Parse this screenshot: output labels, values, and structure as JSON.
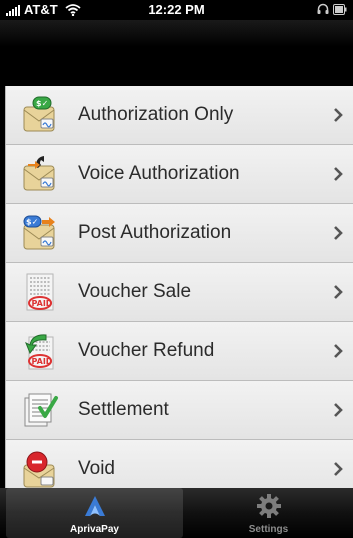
{
  "status_bar": {
    "carrier": "AT&T",
    "time": "12:22 PM"
  },
  "menu": {
    "items": [
      {
        "label": "Authorization Only",
        "icon": "authorization-icon"
      },
      {
        "label": "Voice Authorization",
        "icon": "voice-authorization-icon"
      },
      {
        "label": "Post Authorization",
        "icon": "post-authorization-icon"
      },
      {
        "label": "Voucher Sale",
        "icon": "voucher-sale-icon"
      },
      {
        "label": "Voucher Refund",
        "icon": "voucher-refund-icon"
      },
      {
        "label": "Settlement",
        "icon": "settlement-icon"
      },
      {
        "label": "Void",
        "icon": "void-icon"
      }
    ]
  },
  "tab_bar": {
    "tabs": [
      {
        "label": "AprivaPay",
        "icon": "apriva-logo-icon",
        "active": true
      },
      {
        "label": "Settings",
        "icon": "gear-icon",
        "active": false
      }
    ]
  },
  "colors": {
    "nav_background": "#000000",
    "list_background": "#e9e9e9",
    "row_separator": "#bcbcbc",
    "label_text": "#2b2b2b",
    "tab_active_label": "#ffffff",
    "tab_inactive_label": "#8d8d8d",
    "brand_blue": "#3a7bd5"
  }
}
